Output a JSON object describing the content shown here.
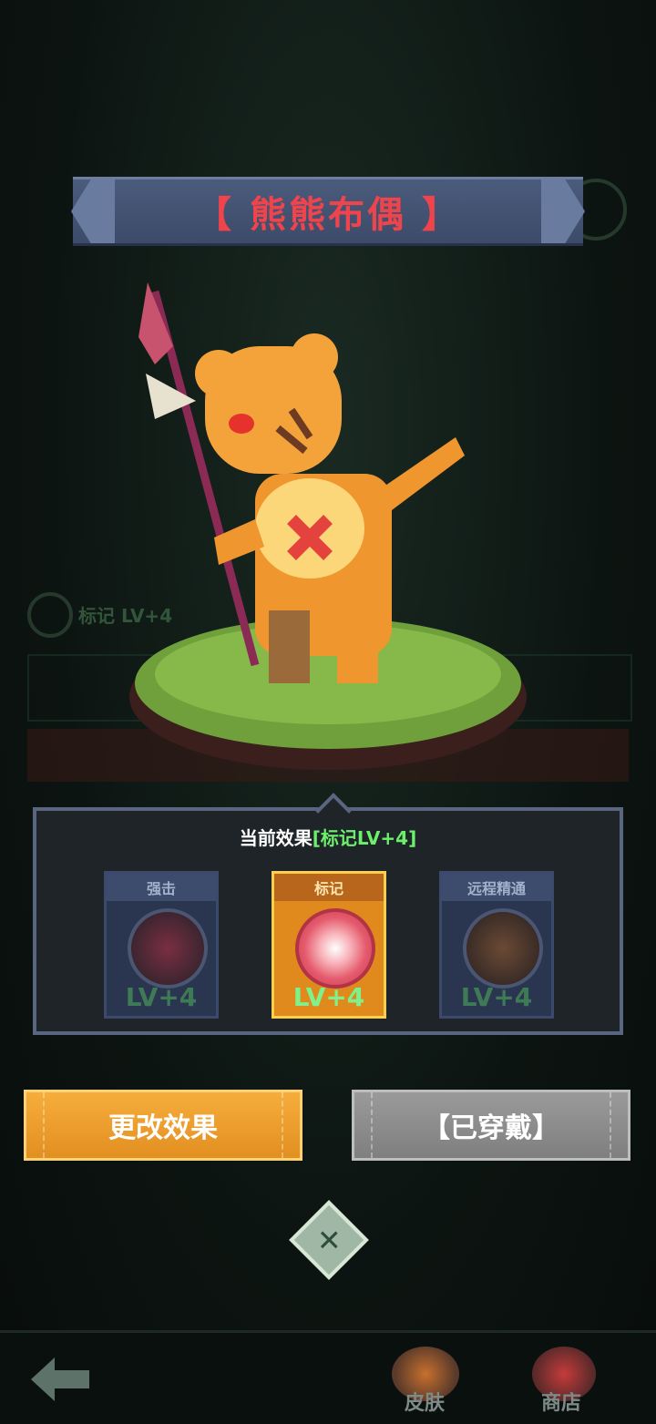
{
  "title": "【 熊熊布偶 】",
  "background": {
    "skill_label": "标记 LV+4"
  },
  "effects": {
    "header_prefix": "当前效果",
    "header_highlight": "[标记LV+4]",
    "cards": [
      {
        "label": "强击",
        "level": "LV+4",
        "icon": "strike-icon",
        "selected": false
      },
      {
        "label": "标记",
        "level": "LV+4",
        "icon": "eye-target-icon",
        "selected": true
      },
      {
        "label": "远程精通",
        "level": "LV+4",
        "icon": "ranged-mastery-icon",
        "selected": false
      }
    ]
  },
  "buttons": {
    "change_label": "更改效果",
    "worn_label": "【已穿戴】"
  },
  "nav": {
    "skins_label": "皮肤",
    "shop_label": "商店"
  },
  "colors": {
    "title_red": "#f0444c",
    "highlight_green": "#6cf06c",
    "active_card": "#e08a1e",
    "change_button": "#f3a233",
    "worn_button": "#8c8c8c"
  }
}
